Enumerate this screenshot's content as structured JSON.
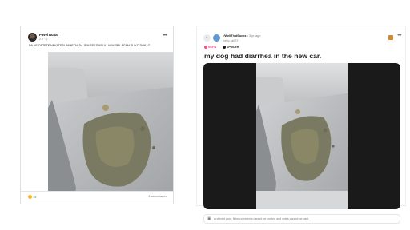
{
  "facebook_post": {
    "author": "Pavel Rupar",
    "time": "2 h · ◎",
    "text": "DA NE OSTETE NEKATERI PAMETNI DA JEM SE IZMISLIL, VAM PRILAGAM SLIKO DOKAZ.",
    "reaction_count": "45",
    "comments_label": "4 komentarjev"
  },
  "reddit_post": {
    "subreddit": "r/WellThatSucks",
    "age": "• 3 yr. ago",
    "user": "Kelby-ss072",
    "tag_nsfw": "NSFW",
    "tag_spoiler": "SPOILER",
    "title": "my dog had diarrhea in the new car.",
    "archive_notice": "Archived post. New comments cannot be posted and votes cannot be cast."
  },
  "colors": {
    "nsfw": "#ff4a88",
    "fb_border": "#dddfe2",
    "reddit_media_bg": "#1a1a1b"
  },
  "icons": [
    "more-horizontal-icon",
    "back-arrow-icon",
    "share-icon",
    "archive-icon",
    "nsfw-dot-icon",
    "spoiler-dot-icon"
  ]
}
